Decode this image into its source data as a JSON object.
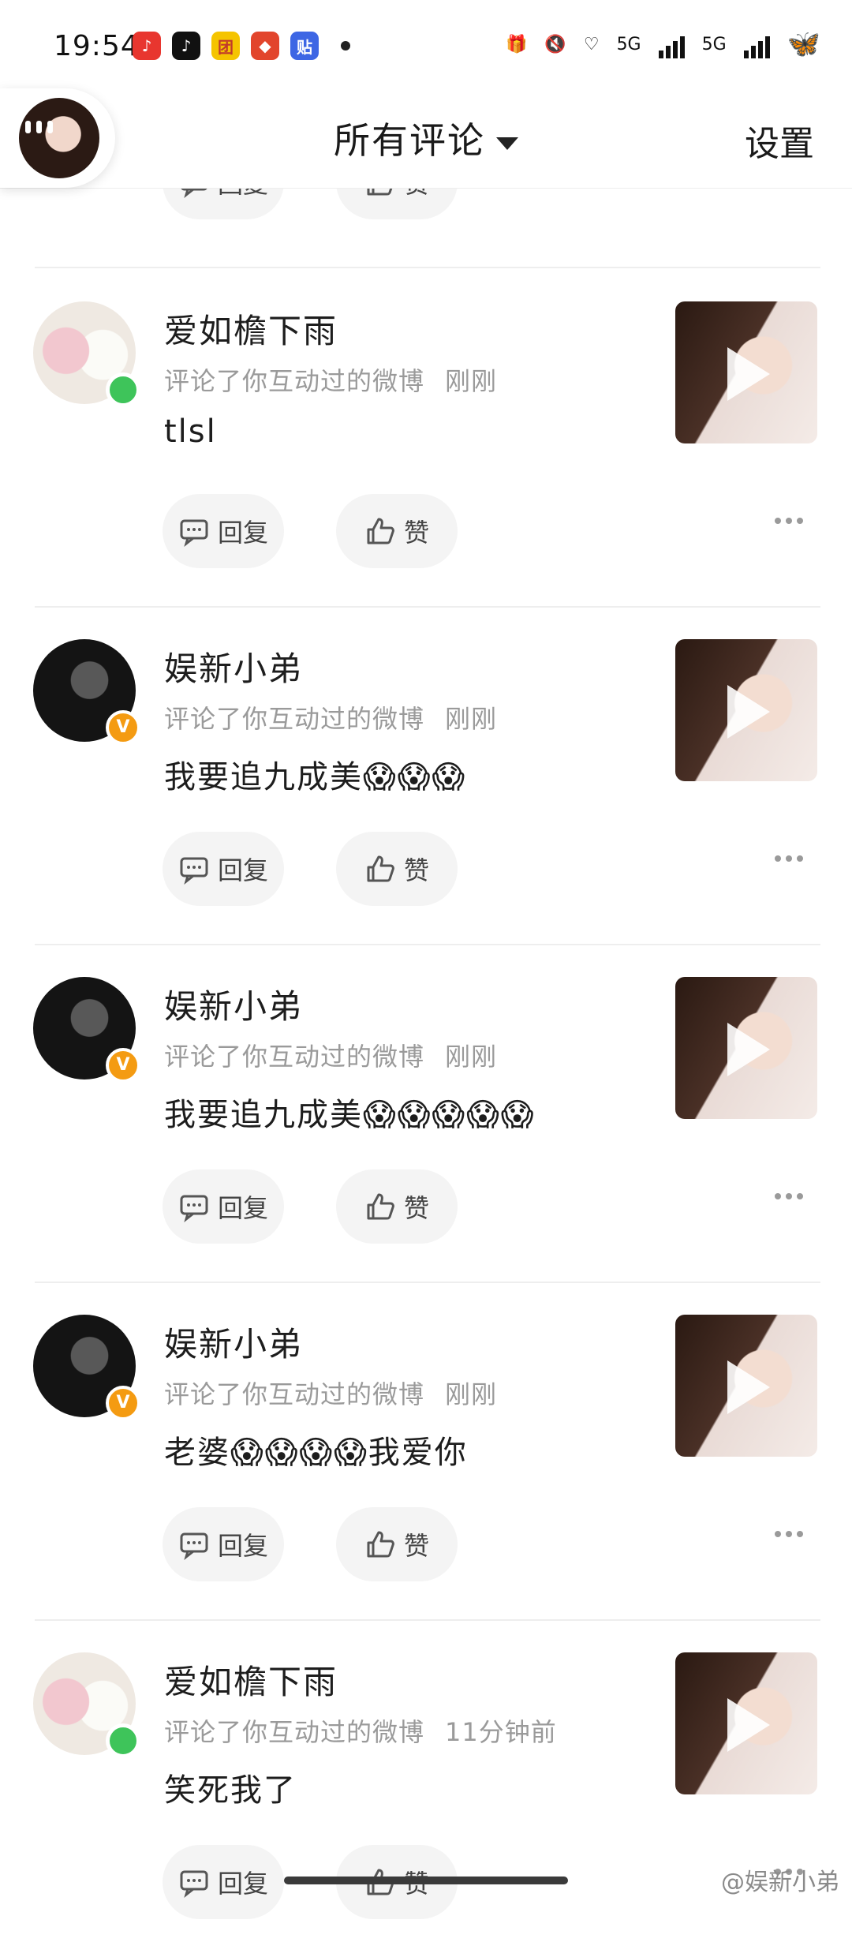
{
  "status_bar": {
    "time": "19:54",
    "apps": [
      {
        "icon": "music-app-icon",
        "color": "#e8362f",
        "glyph": "♪"
      },
      {
        "icon": "tiktok-app-icon",
        "color": "#111111",
        "glyph": "♪"
      },
      {
        "icon": "shopping-app-icon",
        "color": "#f5c400",
        "glyph": "团"
      },
      {
        "icon": "game-app-icon",
        "color": "#e2452c",
        "glyph": "◆"
      },
      {
        "icon": "tieba-app-icon",
        "color": "#3d66e4",
        "glyph": "贴"
      }
    ],
    "network_1": "5G",
    "network_2": "5G"
  },
  "header": {
    "title": "所有评论",
    "settings": "设置"
  },
  "actions": {
    "reply": "回复",
    "like": "赞"
  },
  "comments": [
    {
      "name": "爱如檐下雨",
      "meta": "评论了你互动过的微博",
      "time": "刚刚",
      "text": "tlsl",
      "avatar": "pig",
      "badge": "online"
    },
    {
      "name": "娱新小弟",
      "meta": "评论了你互动过的微博",
      "time": "刚刚",
      "text": "我要追九成美😱😱😱",
      "avatar": "dark",
      "badge": "verified"
    },
    {
      "name": "娱新小弟",
      "meta": "评论了你互动过的微博",
      "time": "刚刚",
      "text": "我要追九成美😱😱😱😱😱",
      "avatar": "dark",
      "badge": "verified"
    },
    {
      "name": "娱新小弟",
      "meta": "评论了你互动过的微博",
      "time": "刚刚",
      "text": "老婆😱😱😱😱我爱你",
      "avatar": "dark",
      "badge": "verified"
    },
    {
      "name": "爱如檐下雨",
      "meta": "评论了你互动过的微博",
      "time": "11分钟前",
      "text": "笑死我了",
      "avatar": "pig",
      "badge": "online"
    }
  ],
  "watermark": "@娱新小弟",
  "colors": {
    "verified": "#f49b12",
    "online": "#3ec45a"
  }
}
